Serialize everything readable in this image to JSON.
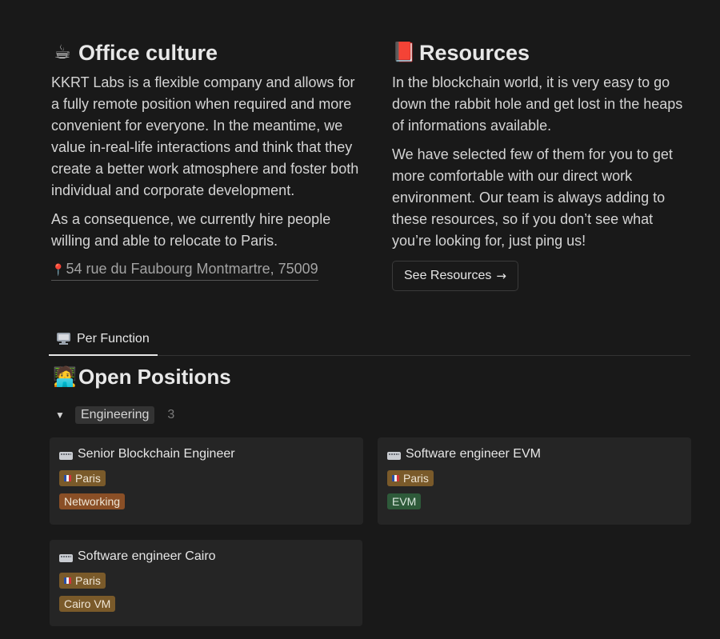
{
  "office": {
    "emoji": "☕",
    "title": "Office culture",
    "paragraphs": [
      "KKRT Labs is a flexible company and allows for a fully remote position when required and more convenient for everyone. In the meantime, we value in-real-life interactions and think that they create a better work atmosphere and foster both individual and corporate development.",
      "As a consequence, we currently hire people willing and able to relocate to Paris."
    ],
    "address_pin": "📍",
    "address": "54 rue du Faubourg Montmartre, 75009"
  },
  "resources": {
    "emoji": "📕",
    "title": "Resources",
    "paragraphs": [
      "In the blockchain world, it is very easy to go down the rabbit hole and get lost in the heaps of informations available.",
      "We have selected few of them for you to get more comfortable with our direct work environment. Our team is always adding to these resources, so if you don’t see what you’re looking for, just ping us!"
    ],
    "button_label": "See Resources",
    "button_arrow": "→"
  },
  "tabs": [
    {
      "label": "Per Function",
      "icon": "monitor-icon"
    }
  ],
  "open_positions": {
    "emoji": "🧑‍💻",
    "title": "Open Positions",
    "group": {
      "toggle": "▼",
      "label": "Engineering",
      "count": "3"
    },
    "cards": [
      {
        "icon": "keyboard-icon",
        "title": "Senior Blockchain Engineer",
        "location": "Paris",
        "tag": "Networking"
      },
      {
        "icon": "keyboard-icon",
        "title": "Software engineer EVM",
        "location": "Paris",
        "tag": "EVM"
      },
      {
        "icon": "keyboard-icon",
        "title": "Software engineer Cairo",
        "location": "Paris",
        "tag": "Cairo VM"
      }
    ]
  },
  "colors": {
    "background": "#191919",
    "card": "#252525",
    "tag_paris": "#7a5a2a",
    "tag_networking": "#8a4f26",
    "tag_evm": "#2e5a3a",
    "tag_cairo": "#7a5a2a"
  }
}
